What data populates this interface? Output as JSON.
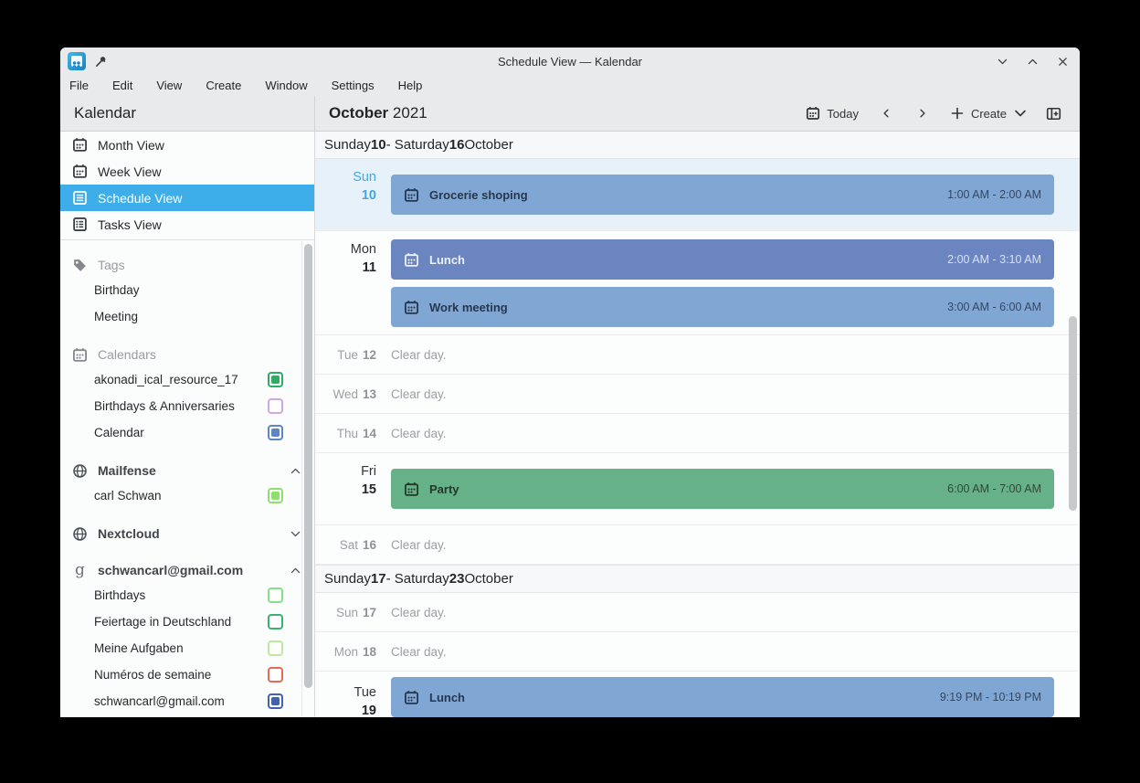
{
  "colors": {
    "accent": "#3daee9",
    "today_row_bg": "#e6f1fa",
    "chrome_bg": "#e8eaeb",
    "event_blue": "#80a7d3",
    "event_indigo": "#6a85c0",
    "event_green": "#66b187"
  },
  "window": {
    "title": "Schedule View — Kalendar"
  },
  "menu_bar": {
    "items": [
      "File",
      "Edit",
      "View",
      "Create",
      "Window",
      "Settings",
      "Help"
    ]
  },
  "header": {
    "app_title": "Kalendar",
    "month": "October",
    "year": "2021"
  },
  "toolbar": {
    "today_label": "Today",
    "create_label": "Create"
  },
  "sidebar": {
    "views": [
      {
        "label": "Month View",
        "selected": false
      },
      {
        "label": "Week View",
        "selected": false
      },
      {
        "label": "Schedule View",
        "selected": true
      },
      {
        "label": "Tasks View",
        "selected": false
      }
    ],
    "tags": {
      "label": "Tags",
      "items": [
        {
          "label": "Birthday"
        },
        {
          "label": "Meeting"
        }
      ]
    },
    "calendars": {
      "label": "Calendars",
      "items": [
        {
          "label": "akonadi_ical_resource_17",
          "color": "#2bae60",
          "checked": true
        },
        {
          "label": "Birthdays & Anniversaries",
          "color": "#cfa7e6",
          "checked": false
        },
        {
          "label": "Calendar",
          "color": "#5b87c9",
          "checked": true
        }
      ]
    },
    "accounts": [
      {
        "name": "Mailfense",
        "chevron": "up",
        "items": [
          {
            "label": "carl Schwan",
            "color": "#8de069",
            "checked": true
          }
        ]
      },
      {
        "name": "Nextcloud",
        "chevron": "down",
        "items": []
      },
      {
        "name": "schwancarl@gmail.com",
        "chevron": "up",
        "google_glyph": "g",
        "items": [
          {
            "label": "Birthdays",
            "color": "#86df86",
            "checked": false
          },
          {
            "label": "Feiertage in Deutschland",
            "color": "#38b270",
            "checked": false
          },
          {
            "label": "Meine Aufgaben",
            "color": "#bde8a2",
            "checked": false
          },
          {
            "label": "Numéros de semaine",
            "color": "#e76a56",
            "checked": false
          },
          {
            "label": "schwancarl@gmail.com",
            "color": "#3f62b5",
            "checked": true
          }
        ]
      }
    ]
  },
  "schedule": {
    "week1": {
      "hdr": {
        "p0": "Sunday ",
        "b0": "10",
        "p1": " - Saturday ",
        "b1": "16",
        "p2": " October"
      },
      "rows": [
        {
          "day": "Sun",
          "num": "10",
          "today": true,
          "events": [
            {
              "title": "Grocerie shoping",
              "time": "1:00 AM - 2:00 AM",
              "bg": "#80a7d3",
              "fg": "#26374f"
            }
          ]
        },
        {
          "day": "Mon",
          "num": "11",
          "events": [
            {
              "title": "Lunch",
              "time": "2:00 AM - 3:10 AM",
              "bg": "#6a85c0",
              "fg": "#edf1f8"
            },
            {
              "title": "Work meeting",
              "time": "3:00 AM - 6:00 AM",
              "bg": "#80a7d3",
              "fg": "#26374f"
            }
          ]
        },
        {
          "day": "Tue",
          "num": "12",
          "clear": "Clear day."
        },
        {
          "day": "Wed",
          "num": "13",
          "clear": "Clear day."
        },
        {
          "day": "Thu",
          "num": "14",
          "clear": "Clear day."
        },
        {
          "day": "Fri",
          "num": "15",
          "events": [
            {
              "title": "Party",
              "time": "6:00 AM - 7:00 AM",
              "bg": "#66b187",
              "fg": "#243829"
            }
          ]
        },
        {
          "day": "Sat",
          "num": "16",
          "clear": "Clear day."
        }
      ]
    },
    "week2": {
      "hdr": {
        "p0": "Sunday ",
        "b0": "17",
        "p1": " - Saturday ",
        "b1": "23",
        "p2": " October"
      },
      "rows": [
        {
          "day": "Sun",
          "num": "17",
          "clear": "Clear day."
        },
        {
          "day": "Mon",
          "num": "18",
          "clear": "Clear day."
        },
        {
          "day": "Tue",
          "num": "19",
          "events": [
            {
              "title": "Lunch",
              "time": "9:19 PM - 10:19 PM",
              "bg": "#80a7d3",
              "fg": "#26374f"
            }
          ]
        }
      ]
    }
  }
}
